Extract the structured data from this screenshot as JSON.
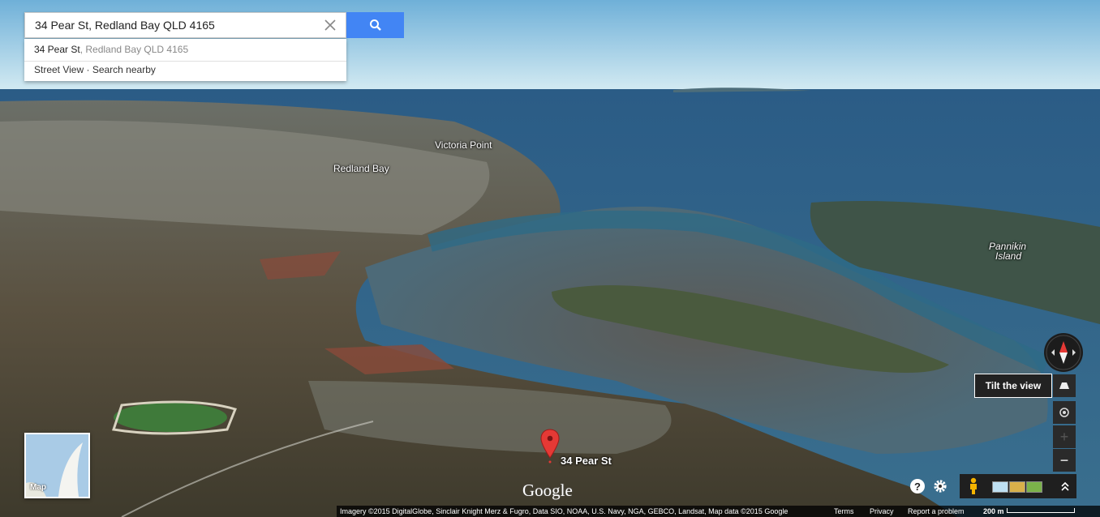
{
  "search": {
    "value": "34 Pear St, Redland Bay QLD 4165"
  },
  "suggestion": {
    "primary": "34 Pear St",
    "secondary": ", Redland Bay QLD 4165",
    "street_view": "Street View",
    "separator": " · ",
    "search_nearby": "Search nearby"
  },
  "map_labels": {
    "victoria_point": "Victoria Point",
    "redland_bay": "Redland Bay",
    "pannikin_1": "Pannikin",
    "pannikin_2": "Island"
  },
  "pin": {
    "label": "34 Pear St",
    "color": "#e53935"
  },
  "logo": "Google",
  "minimap": {
    "label": "Map"
  },
  "controls": {
    "tooltip": "Tilt the view",
    "zoom_in": "+",
    "zoom_out": "−"
  },
  "footer": {
    "attribution": "Imagery ©2015 DigitalGlobe, Sinclair Knight Merz & Fugro, Data SIO, NOAA, U.S. Navy, NGA, GEBCO, Landsat, Map data ©2015 Google",
    "terms": "Terms",
    "privacy": "Privacy",
    "report": "Report a problem",
    "scale": "200 m"
  },
  "icons": {
    "search": "search-icon",
    "clear": "close-icon",
    "help": "help-icon",
    "settings": "gear-icon",
    "pegman": "pegman-icon",
    "expand": "chevron-up-icon"
  },
  "colors": {
    "accent": "#4285f4",
    "water": "#3b6c8a",
    "land": "#5a5a3a"
  }
}
